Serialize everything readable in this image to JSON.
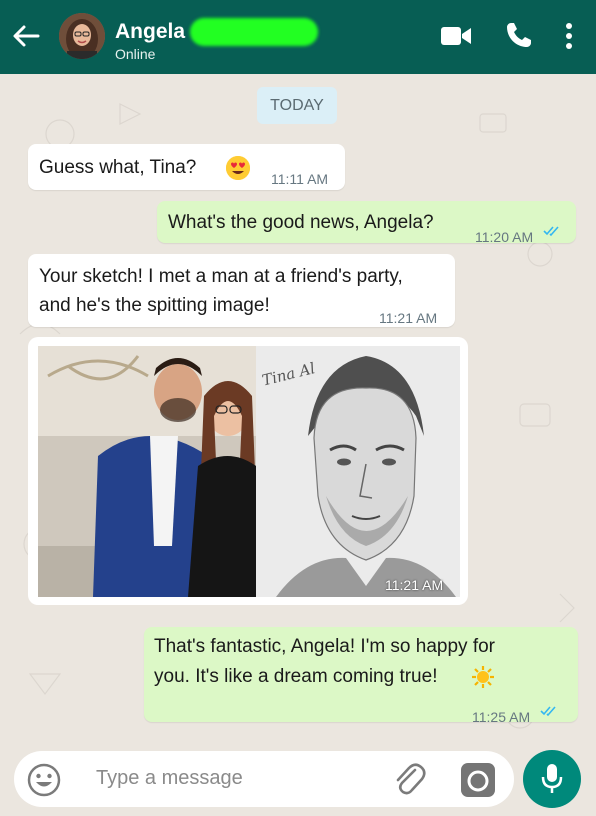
{
  "header": {
    "contact_name": "Angela",
    "status": "Online",
    "icons": [
      "back-arrow-icon",
      "video-call-icon",
      "phone-icon",
      "more-vert-icon"
    ],
    "bg_color": "#075e54"
  },
  "date_chip": "TODAY",
  "messages": [
    {
      "direction": "in",
      "lines": [
        "Guess what, Tina?"
      ],
      "emoji": "heart-eyes-emoji",
      "time": "11:11 AM"
    },
    {
      "direction": "out",
      "lines": [
        "What's the good news, Angela?"
      ],
      "time": "11:20 AM",
      "read": true
    },
    {
      "direction": "in",
      "lines": [
        "Your sketch! I met a man at a friend's party,",
        "and he's the spitting image!"
      ],
      "time": "11:21 AM"
    },
    {
      "direction": "in",
      "type": "image",
      "time": "11:21 AM",
      "signature": "Tina Al"
    },
    {
      "direction": "out",
      "lines": [
        "That's fantastic, Angela! I'm so happy for",
        "you. It's like a dream coming true!"
      ],
      "emoji": "sun-emoji",
      "time": "11:25 AM",
      "read": true
    }
  ],
  "input": {
    "placeholder": "Type a message",
    "icons": [
      "emoji-icon",
      "attach-icon",
      "camera-icon",
      "mic-icon"
    ]
  },
  "colors": {
    "incoming": "#ffffff",
    "outgoing": "#dcf8c6",
    "tick": "#34b7f1",
    "accent": "#00897b"
  }
}
